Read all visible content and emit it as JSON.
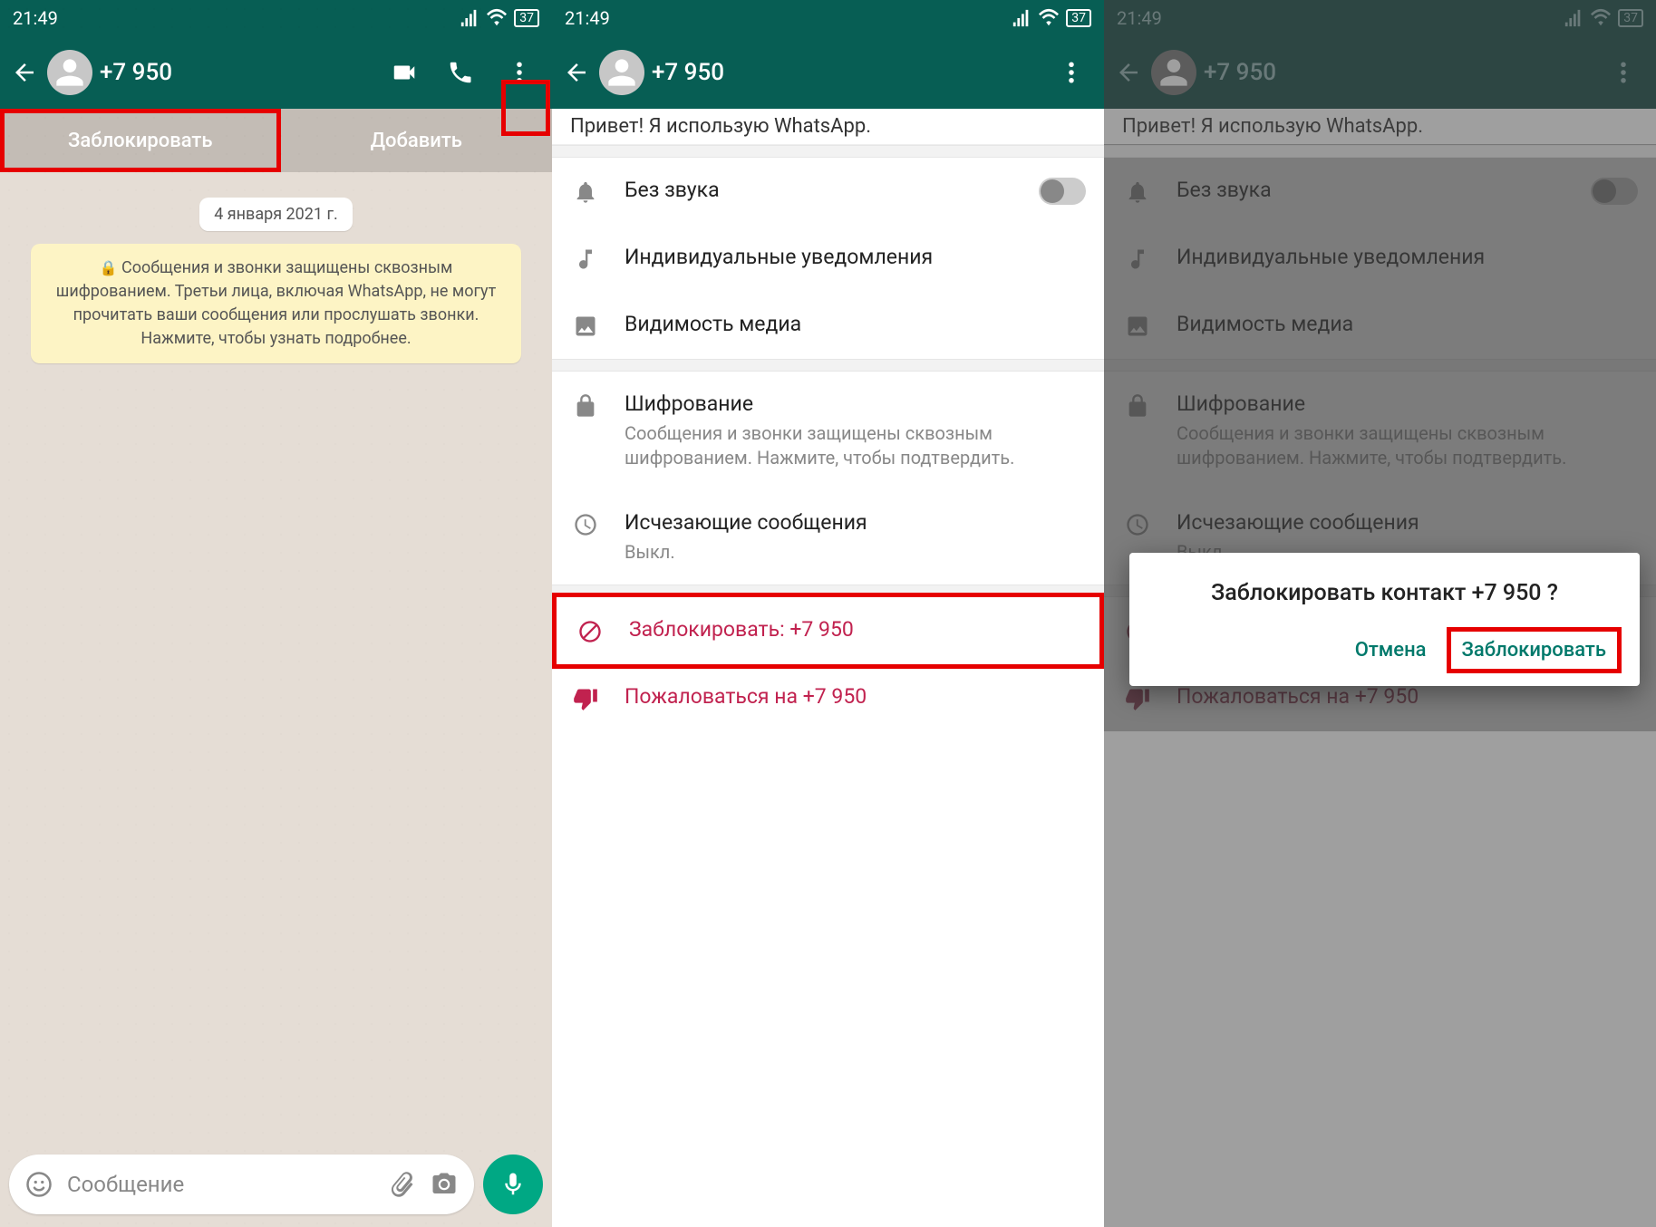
{
  "status": {
    "time": "21:49",
    "battery": "37"
  },
  "header": {
    "contact": "+7 950"
  },
  "panel1": {
    "block_label": "Заблокировать",
    "add_label": "Добавить",
    "date": "4 января 2021 г.",
    "encryption_notice": "Сообщения и звонки защищены сквозным шифрованием. Третьи лица, включая WhatsApp, не могут прочитать ваши сообщения или прослушать звонки. Нажмите, чтобы узнать подробнее.",
    "input_placeholder": "Сообщение"
  },
  "settings": {
    "partial_top": "Привет! Я использую WhatsApp.",
    "mute": "Без звука",
    "custom_notif": "Индивидуальные уведомления",
    "media_vis": "Видимость медиа",
    "encryption_title": "Шифрование",
    "encryption_sub": "Сообщения и звонки защищены сквозным шифрованием. Нажмите, чтобы подтвердить.",
    "disappearing_title": "Исчезающие сообщения",
    "disappearing_sub": "Выкл.",
    "block": "Заблокировать: +7 950",
    "report": "Пожаловаться на +7 950"
  },
  "dialog": {
    "title": "Заблокировать контакт +7 950 ?",
    "cancel": "Отмена",
    "confirm": "Заблокировать"
  }
}
